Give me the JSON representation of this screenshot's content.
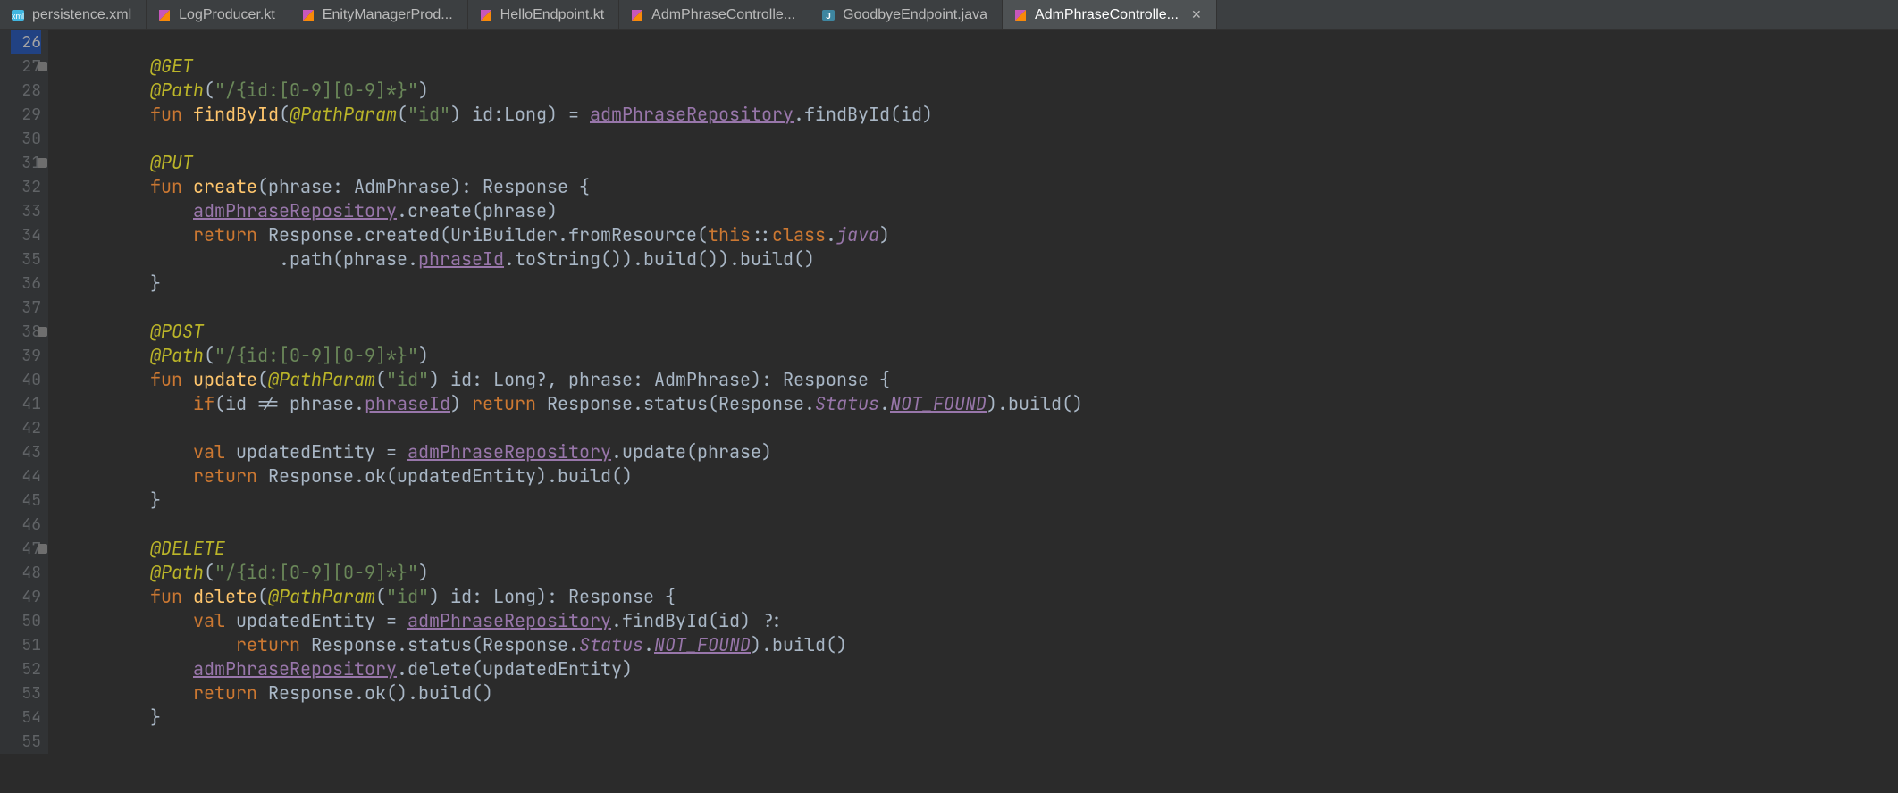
{
  "tabs": [
    {
      "icon": "xml",
      "label": "persistence.xml",
      "close": false
    },
    {
      "icon": "kt",
      "label": "LogProducer.kt",
      "close": false
    },
    {
      "icon": "kt",
      "label": "EnityManagerProd...",
      "close": false
    },
    {
      "icon": "kt",
      "label": "HelloEndpoint.kt",
      "close": false
    },
    {
      "icon": "kt",
      "label": "AdmPhraseControlle...",
      "close": false
    },
    {
      "icon": "java",
      "label": "GoodbyeEndpoint.java",
      "close": false
    },
    {
      "icon": "kt",
      "label": "AdmPhraseControlle...",
      "close": true,
      "active": true
    }
  ],
  "gutter": {
    "start": 26,
    "end": 55,
    "folds": [
      27,
      31,
      38,
      47
    ],
    "current": 26
  },
  "code": {
    "lines": [
      {
        "n": 26,
        "tokens": []
      },
      {
        "n": 27,
        "indent": 8,
        "tokens": [
          [
            "anno",
            "@GET"
          ]
        ]
      },
      {
        "n": 28,
        "indent": 8,
        "tokens": [
          [
            "anno",
            "@Path"
          ],
          [
            "punct",
            "("
          ],
          [
            "str",
            "\"/{id:[0-9][0-9]*}\""
          ],
          [
            "punct",
            ")"
          ]
        ]
      },
      {
        "n": 29,
        "indent": 8,
        "tokens": [
          [
            "kw",
            "fun "
          ],
          [
            "fn",
            "findById"
          ],
          [
            "punct",
            "("
          ],
          [
            "anno",
            "@PathParam"
          ],
          [
            "punct",
            "("
          ],
          [
            "str",
            "\"id\""
          ],
          [
            "punct",
            ") "
          ],
          [
            "ident",
            "id"
          ],
          [
            "punct",
            ":"
          ],
          [
            "type",
            "Long"
          ],
          [
            "punct",
            ") = "
          ],
          [
            "field",
            "admPhraseRepository"
          ],
          [
            "punct",
            "."
          ],
          [
            "call",
            "findById"
          ],
          [
            "punct",
            "("
          ],
          [
            "ident",
            "id"
          ],
          [
            "punct",
            ")"
          ]
        ]
      },
      {
        "n": 30,
        "tokens": []
      },
      {
        "n": 31,
        "indent": 8,
        "tokens": [
          [
            "anno",
            "@PUT"
          ]
        ]
      },
      {
        "n": 32,
        "indent": 8,
        "tokens": [
          [
            "kw",
            "fun "
          ],
          [
            "fn",
            "create"
          ],
          [
            "punct",
            "("
          ],
          [
            "ident",
            "phrase"
          ],
          [
            "punct",
            ": "
          ],
          [
            "type",
            "AdmPhrase"
          ],
          [
            "punct",
            ")"
          ],
          [
            "punct",
            ": "
          ],
          [
            "type",
            "Response"
          ],
          [
            "punct",
            " {"
          ]
        ]
      },
      {
        "n": 33,
        "indent": 12,
        "tokens": [
          [
            "field",
            "admPhraseRepository"
          ],
          [
            "punct",
            "."
          ],
          [
            "call",
            "create"
          ],
          [
            "punct",
            "("
          ],
          [
            "ident",
            "phrase"
          ],
          [
            "punct",
            ")"
          ]
        ]
      },
      {
        "n": 34,
        "indent": 12,
        "tokens": [
          [
            "kw",
            "return "
          ],
          [
            "type",
            "Response"
          ],
          [
            "punct",
            "."
          ],
          [
            "call",
            "created"
          ],
          [
            "punct",
            "("
          ],
          [
            "type",
            "UriBuilder"
          ],
          [
            "punct",
            "."
          ],
          [
            "call",
            "fromResource"
          ],
          [
            "punct",
            "("
          ],
          [
            "kw",
            "this"
          ],
          [
            "punct",
            "::"
          ],
          [
            "kw",
            "class"
          ],
          [
            "punct",
            "."
          ],
          [
            "prop",
            "java"
          ],
          [
            "punct",
            ")"
          ]
        ]
      },
      {
        "n": 35,
        "indent": 20,
        "tokens": [
          [
            "punct",
            "."
          ],
          [
            "call",
            "path"
          ],
          [
            "punct",
            "("
          ],
          [
            "ident",
            "phrase"
          ],
          [
            "punct",
            "."
          ],
          [
            "field",
            "phraseId"
          ],
          [
            "punct",
            "."
          ],
          [
            "call",
            "toString"
          ],
          [
            "punct",
            "())."
          ],
          [
            "call",
            "build"
          ],
          [
            "punct",
            "())."
          ],
          [
            "call",
            "build"
          ],
          [
            "punct",
            "()"
          ]
        ]
      },
      {
        "n": 36,
        "indent": 8,
        "tokens": [
          [
            "punct",
            "}"
          ]
        ]
      },
      {
        "n": 37,
        "tokens": []
      },
      {
        "n": 38,
        "indent": 8,
        "tokens": [
          [
            "anno",
            "@POST"
          ]
        ]
      },
      {
        "n": 39,
        "indent": 8,
        "tokens": [
          [
            "anno",
            "@Path"
          ],
          [
            "punct",
            "("
          ],
          [
            "str",
            "\"/{id:[0-9][0-9]*}\""
          ],
          [
            "punct",
            ")"
          ]
        ]
      },
      {
        "n": 40,
        "indent": 8,
        "tokens": [
          [
            "kw",
            "fun "
          ],
          [
            "fn",
            "update"
          ],
          [
            "punct",
            "("
          ],
          [
            "anno",
            "@PathParam"
          ],
          [
            "punct",
            "("
          ],
          [
            "str",
            "\"id\""
          ],
          [
            "punct",
            ") "
          ],
          [
            "ident",
            "id"
          ],
          [
            "punct",
            ": "
          ],
          [
            "type",
            "Long?"
          ],
          [
            "punct",
            ", "
          ],
          [
            "ident",
            "phrase"
          ],
          [
            "punct",
            ": "
          ],
          [
            "type",
            "AdmPhrase"
          ],
          [
            "punct",
            ")"
          ],
          [
            "punct",
            ": "
          ],
          [
            "type",
            "Response"
          ],
          [
            "punct",
            " {"
          ]
        ]
      },
      {
        "n": 41,
        "indent": 12,
        "tokens": [
          [
            "kw",
            "if"
          ],
          [
            "punct",
            "("
          ],
          [
            "ident",
            "id"
          ],
          [
            "punct",
            " != "
          ],
          [
            "ident",
            "phrase"
          ],
          [
            "punct",
            "."
          ],
          [
            "field",
            "phraseId"
          ],
          [
            "punct",
            ") "
          ],
          [
            "kw",
            "return "
          ],
          [
            "type",
            "Response"
          ],
          [
            "punct",
            "."
          ],
          [
            "call",
            "status"
          ],
          [
            "punct",
            "("
          ],
          [
            "type",
            "Response"
          ],
          [
            "punct",
            "."
          ],
          [
            "enum",
            "Status"
          ],
          [
            "punct",
            "."
          ],
          [
            "fielditalic",
            "NOT_FOUND"
          ],
          [
            "punct",
            ")."
          ],
          [
            "call",
            "build"
          ],
          [
            "punct",
            "()"
          ]
        ]
      },
      {
        "n": 42,
        "tokens": []
      },
      {
        "n": 43,
        "indent": 12,
        "tokens": [
          [
            "kw",
            "val "
          ],
          [
            "ident",
            "updatedEntity"
          ],
          [
            "punct",
            " = "
          ],
          [
            "field",
            "admPhraseRepository"
          ],
          [
            "punct",
            "."
          ],
          [
            "call",
            "update"
          ],
          [
            "punct",
            "("
          ],
          [
            "ident",
            "phrase"
          ],
          [
            "punct",
            ")"
          ]
        ]
      },
      {
        "n": 44,
        "indent": 12,
        "tokens": [
          [
            "kw",
            "return "
          ],
          [
            "type",
            "Response"
          ],
          [
            "punct",
            "."
          ],
          [
            "call",
            "ok"
          ],
          [
            "punct",
            "("
          ],
          [
            "ident",
            "updatedEntity"
          ],
          [
            "punct",
            ")."
          ],
          [
            "call",
            "build"
          ],
          [
            "punct",
            "()"
          ]
        ]
      },
      {
        "n": 45,
        "indent": 8,
        "tokens": [
          [
            "punct",
            "}"
          ]
        ]
      },
      {
        "n": 46,
        "tokens": []
      },
      {
        "n": 47,
        "indent": 8,
        "tokens": [
          [
            "anno",
            "@DELETE"
          ]
        ]
      },
      {
        "n": 48,
        "indent": 8,
        "tokens": [
          [
            "anno",
            "@Path"
          ],
          [
            "punct",
            "("
          ],
          [
            "str",
            "\"/{id:[0-9][0-9]*}\""
          ],
          [
            "punct",
            ")"
          ]
        ]
      },
      {
        "n": 49,
        "indent": 8,
        "tokens": [
          [
            "kw",
            "fun "
          ],
          [
            "fn",
            "delete"
          ],
          [
            "punct",
            "("
          ],
          [
            "anno",
            "@PathParam"
          ],
          [
            "punct",
            "("
          ],
          [
            "str",
            "\"id\""
          ],
          [
            "punct",
            ") "
          ],
          [
            "ident",
            "id"
          ],
          [
            "punct",
            ": "
          ],
          [
            "type",
            "Long"
          ],
          [
            "punct",
            ")"
          ],
          [
            "punct",
            ": "
          ],
          [
            "type",
            "Response"
          ],
          [
            "punct",
            " {"
          ]
        ]
      },
      {
        "n": 50,
        "indent": 12,
        "tokens": [
          [
            "kw",
            "val "
          ],
          [
            "ident",
            "updatedEntity"
          ],
          [
            "punct",
            " = "
          ],
          [
            "field",
            "admPhraseRepository"
          ],
          [
            "punct",
            "."
          ],
          [
            "call",
            "findById"
          ],
          [
            "punct",
            "("
          ],
          [
            "ident",
            "id"
          ],
          [
            "punct",
            ") ?:"
          ]
        ]
      },
      {
        "n": 51,
        "indent": 16,
        "tokens": [
          [
            "kw",
            "return "
          ],
          [
            "type",
            "Response"
          ],
          [
            "punct",
            "."
          ],
          [
            "call",
            "status"
          ],
          [
            "punct",
            "("
          ],
          [
            "type",
            "Response"
          ],
          [
            "punct",
            "."
          ],
          [
            "enum",
            "Status"
          ],
          [
            "punct",
            "."
          ],
          [
            "fielditalic",
            "NOT_FOUND"
          ],
          [
            "punct",
            ")."
          ],
          [
            "call",
            "build"
          ],
          [
            "punct",
            "()"
          ]
        ]
      },
      {
        "n": 52,
        "indent": 12,
        "tokens": [
          [
            "field",
            "admPhraseRepository"
          ],
          [
            "punct",
            "."
          ],
          [
            "call",
            "delete"
          ],
          [
            "punct",
            "("
          ],
          [
            "ident",
            "updatedEntity"
          ],
          [
            "punct",
            ")"
          ]
        ]
      },
      {
        "n": 53,
        "indent": 12,
        "tokens": [
          [
            "kw",
            "return "
          ],
          [
            "type",
            "Response"
          ],
          [
            "punct",
            "."
          ],
          [
            "call",
            "ok"
          ],
          [
            "punct",
            "()."
          ],
          [
            "call",
            "build"
          ],
          [
            "punct",
            "()"
          ]
        ]
      },
      {
        "n": 54,
        "indent": 8,
        "tokens": [
          [
            "punct",
            "}"
          ]
        ]
      },
      {
        "n": 55,
        "tokens": []
      }
    ]
  }
}
